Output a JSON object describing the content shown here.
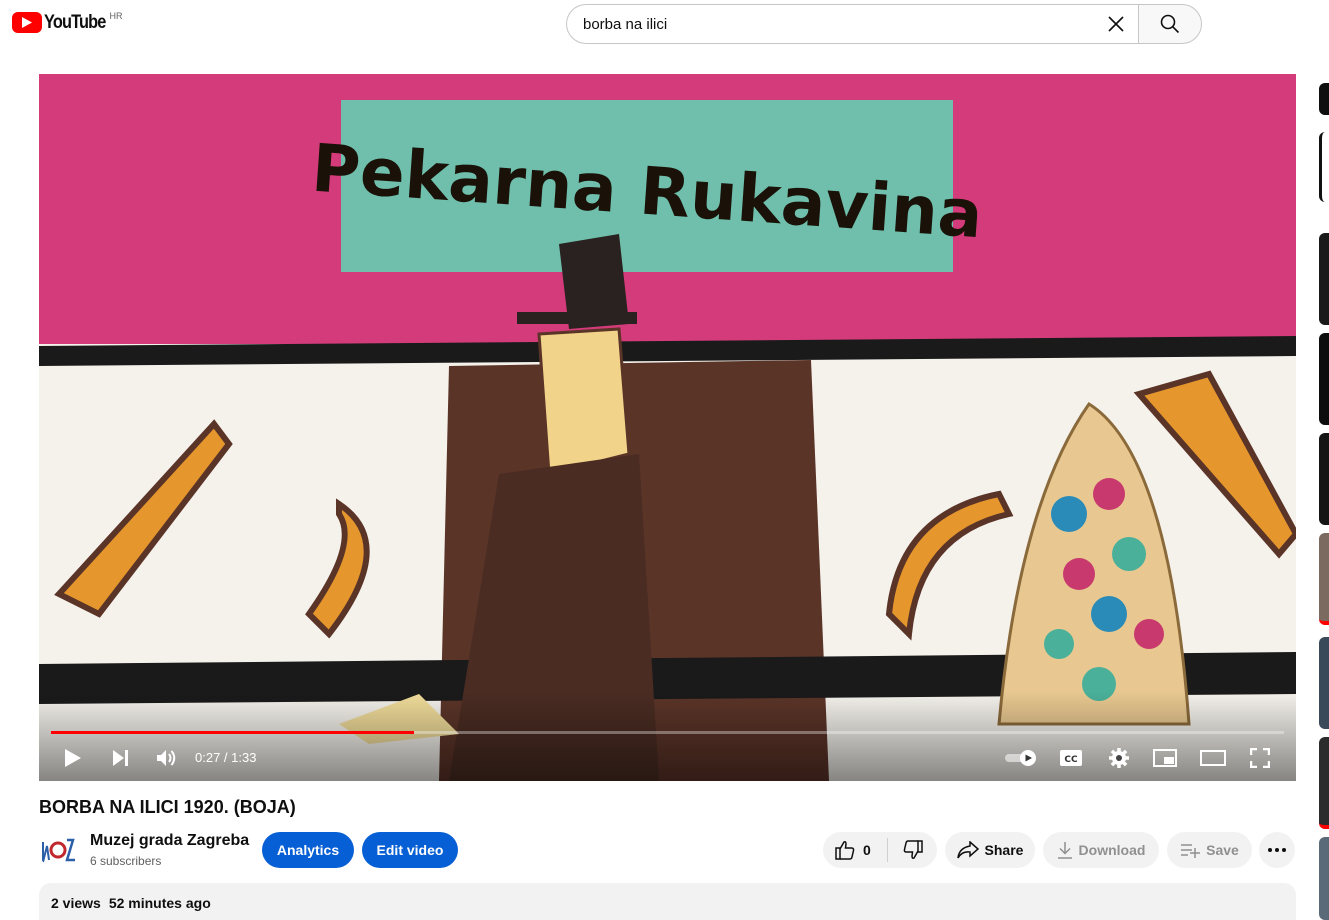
{
  "header": {
    "logo_text": "YouTube",
    "country_code": "HR",
    "search_value": "borba na ilici"
  },
  "player": {
    "time_current": "0:27",
    "time_separator": " / ",
    "time_total": "1:33",
    "progress_fraction": 0.294,
    "sign_text": "Pekarna Rukavina",
    "colors": {
      "progress": "#ff0000",
      "wall": "#d43b7a",
      "sign": "#6fbfac"
    }
  },
  "video": {
    "title": "BORBA NA ILICI 1920. (BOJA)",
    "channel": "Muzej grada Zagreba",
    "subscribers": "6 subscribers",
    "analytics_label": "Analytics",
    "edit_label": "Edit video",
    "likes": "0",
    "share_label": "Share",
    "download_label": "Download",
    "save_label": "Save"
  },
  "description": {
    "views": "2 views",
    "age": "52 minutes ago"
  },
  "theme": {
    "brand_red": "#ff0000",
    "accent_blue": "#065fd4",
    "chip_grey": "#f2f2f2"
  }
}
